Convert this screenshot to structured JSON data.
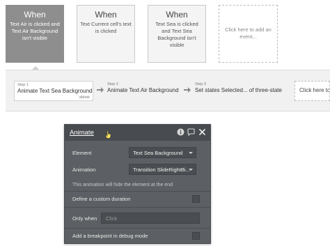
{
  "events": [
    {
      "heading": "When",
      "description": "Text Air is clicked and Text Air Background isn't visible",
      "selected": true
    },
    {
      "heading": "When",
      "description": "Text Current cell's text is clicked",
      "selected": false
    },
    {
      "heading": "When",
      "description": "Text Sea is clicked and Text Sea Background isn't visible",
      "selected": false
    }
  ],
  "add_event_label": "Click here to add an event...",
  "steps": [
    {
      "number": "Step 1",
      "title": "Animate Text Sea Background",
      "delete_label": "delete"
    },
    {
      "number": "Step 2",
      "title": "Animate Text Air Background"
    },
    {
      "number": "Step 3",
      "title": "Set states Selected... of three-state"
    }
  ],
  "add_action_label": "Click here to",
  "panel": {
    "title": "Animate",
    "header_icons": [
      "info-icon",
      "comment-icon",
      "close-icon"
    ],
    "element_label": "Element",
    "element_value": "Text Sea Background",
    "animation_label": "Animation",
    "animation_value": "Transition SlideRightBi...",
    "note": "This animation will hide the element at the end",
    "custom_duration_label": "Define a custom duration",
    "only_when_label": "Only when",
    "only_when_placeholder": "Click",
    "breakpoint_label": "Add a breakpoint in debug mode"
  },
  "colors": {
    "selected_card": "#8e8e8e",
    "panel_bg": "#5c5f63",
    "panel_header": "#484b4f"
  }
}
